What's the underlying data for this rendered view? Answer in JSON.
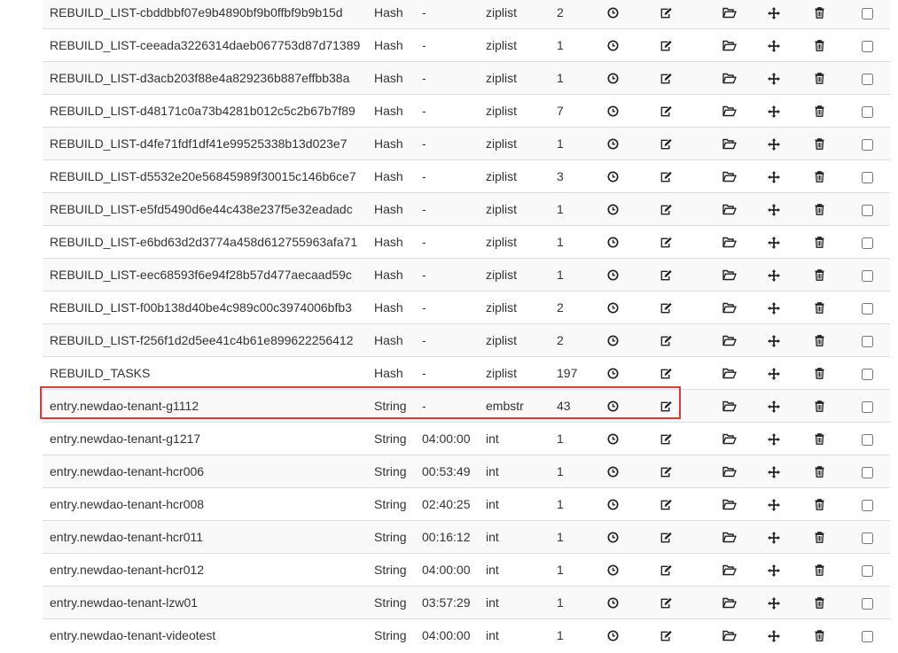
{
  "highlight_color": "#e0393b",
  "icons": {
    "ttl": "clock-icon",
    "edit": "edit-icon",
    "open": "folder-open-icon",
    "move": "move-icon",
    "delete": "trash-icon",
    "select": "checkbox"
  },
  "highlighted_key": "entry.newdao-tenant-g1112",
  "rows": [
    {
      "key": "REBUILD_LIST-cbddbbf07e9b4890bf9b0ffbf9b9b15d",
      "type": "Hash",
      "ttl": "-",
      "encoding": "ziplist",
      "size": "2"
    },
    {
      "key": "REBUILD_LIST-ceeada3226314daeb067753d87d71389",
      "type": "Hash",
      "ttl": "-",
      "encoding": "ziplist",
      "size": "1"
    },
    {
      "key": "REBUILD_LIST-d3acb203f88e4a829236b887effbb38a",
      "type": "Hash",
      "ttl": "-",
      "encoding": "ziplist",
      "size": "1"
    },
    {
      "key": "REBUILD_LIST-d48171c0a73b4281b012c5c2b67b7f89",
      "type": "Hash",
      "ttl": "-",
      "encoding": "ziplist",
      "size": "7"
    },
    {
      "key": "REBUILD_LIST-d4fe71fdf1df41e99525338b13d023e7",
      "type": "Hash",
      "ttl": "-",
      "encoding": "ziplist",
      "size": "1"
    },
    {
      "key": "REBUILD_LIST-d5532e20e56845989f30015c146b6ce7",
      "type": "Hash",
      "ttl": "-",
      "encoding": "ziplist",
      "size": "3"
    },
    {
      "key": "REBUILD_LIST-e5fd5490d6e44c438e237f5e32eadadc",
      "type": "Hash",
      "ttl": "-",
      "encoding": "ziplist",
      "size": "1"
    },
    {
      "key": "REBUILD_LIST-e6bd63d2d3774a458d612755963afa71",
      "type": "Hash",
      "ttl": "-",
      "encoding": "ziplist",
      "size": "1"
    },
    {
      "key": "REBUILD_LIST-eec68593f6e94f28b57d477aecaad59c",
      "type": "Hash",
      "ttl": "-",
      "encoding": "ziplist",
      "size": "1"
    },
    {
      "key": "REBUILD_LIST-f00b138d40be4c989c00c3974006bfb3",
      "type": "Hash",
      "ttl": "-",
      "encoding": "ziplist",
      "size": "2"
    },
    {
      "key": "REBUILD_LIST-f256f1d2d5ee41c4b61e899622256412",
      "type": "Hash",
      "ttl": "-",
      "encoding": "ziplist",
      "size": "2"
    },
    {
      "key": "REBUILD_TASKS",
      "type": "Hash",
      "ttl": "-",
      "encoding": "ziplist",
      "size": "197"
    },
    {
      "key": "entry.newdao-tenant-g1112",
      "type": "String",
      "ttl": "-",
      "encoding": "embstr",
      "size": "43"
    },
    {
      "key": "entry.newdao-tenant-g1217",
      "type": "String",
      "ttl": "04:00:00",
      "encoding": "int",
      "size": "1"
    },
    {
      "key": "entry.newdao-tenant-hcr006",
      "type": "String",
      "ttl": "00:53:49",
      "encoding": "int",
      "size": "1"
    },
    {
      "key": "entry.newdao-tenant-hcr008",
      "type": "String",
      "ttl": "02:40:25",
      "encoding": "int",
      "size": "1"
    },
    {
      "key": "entry.newdao-tenant-hcr011",
      "type": "String",
      "ttl": "00:16:12",
      "encoding": "int",
      "size": "1"
    },
    {
      "key": "entry.newdao-tenant-hcr012",
      "type": "String",
      "ttl": "04:00:00",
      "encoding": "int",
      "size": "1"
    },
    {
      "key": "entry.newdao-tenant-lzw01",
      "type": "String",
      "ttl": "03:57:29",
      "encoding": "int",
      "size": "1"
    },
    {
      "key": "entry.newdao-tenant-videotest",
      "type": "String",
      "ttl": "04:00:00",
      "encoding": "int",
      "size": "1"
    }
  ]
}
